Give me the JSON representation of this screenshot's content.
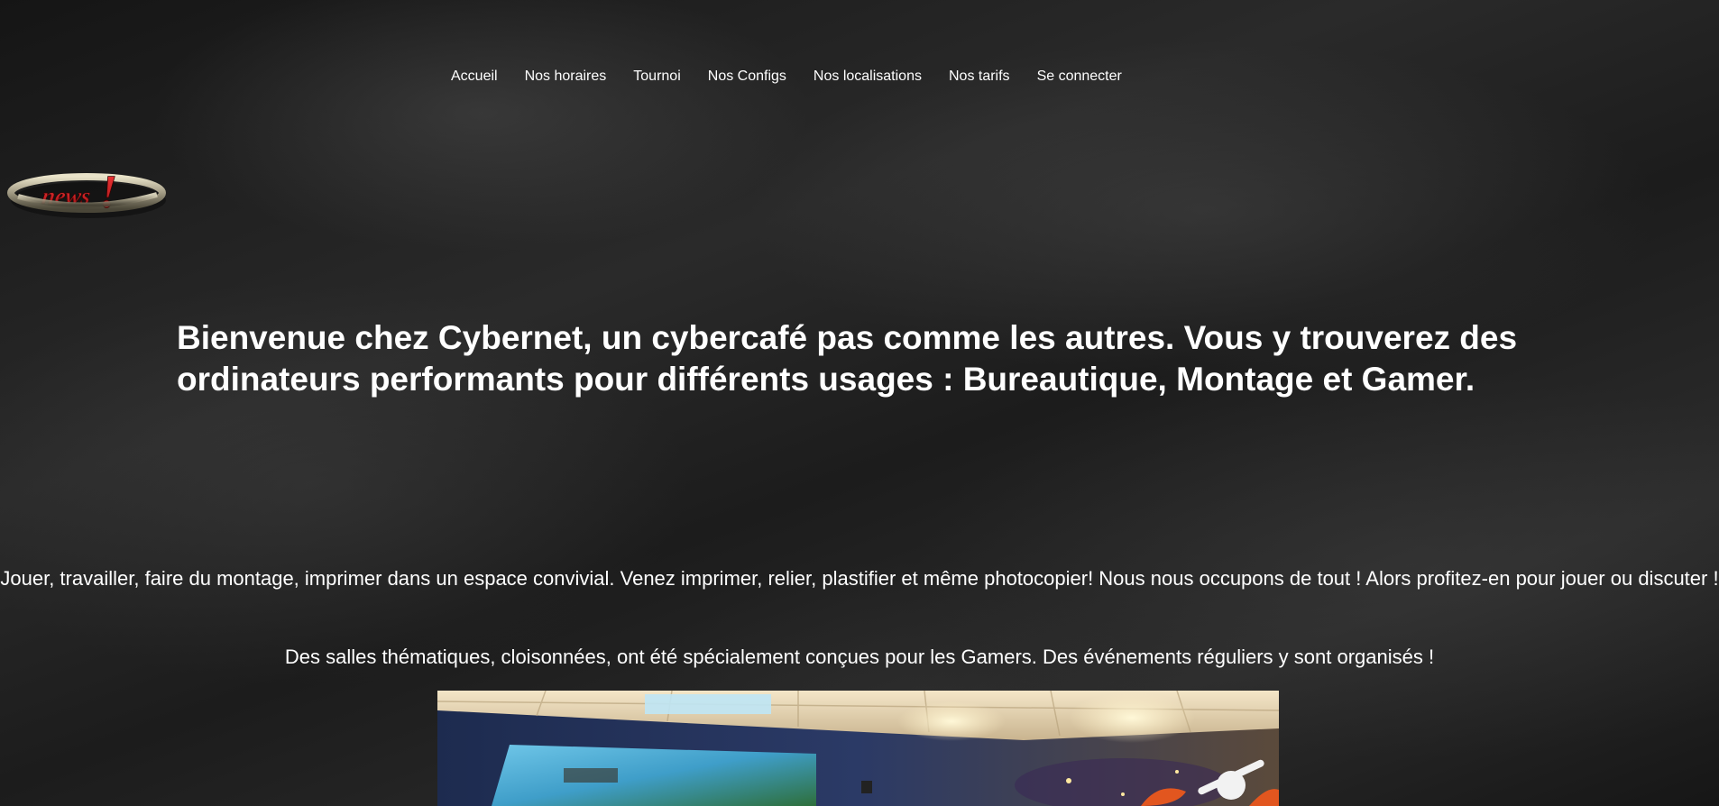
{
  "nav": {
    "items": [
      {
        "label": "Accueil"
      },
      {
        "label": "Nos horaires"
      },
      {
        "label": "Tournoi"
      },
      {
        "label": "Nos Configs"
      },
      {
        "label": "Nos localisations"
      },
      {
        "label": "Nos tarifs"
      },
      {
        "label": "Se connecter"
      }
    ]
  },
  "logo": {
    "text": "news!",
    "accent_color": "#c8161d"
  },
  "headline": "Bienvenue chez Cybernet, un cybercafé pas comme les autres. Vous y trouverez des ordinateurs performants pour différents usages : Bureautique, Montage et Gamer.",
  "paragraphs": [
    "Jouer, travailler, faire du montage, imprimer dans un espace convivial. Venez imprimer, relier, plastifier et même photocopier! Nous nous occupons de tout ! Alors profitez-en pour jouer ou discuter !",
    "Des salles thématiques, cloisonnées, ont été spécialement conçues pour les Gamers. Des événements réguliers y sont organisés !"
  ],
  "colors": {
    "text": "#ffffff",
    "background": "#1b1b1b"
  }
}
